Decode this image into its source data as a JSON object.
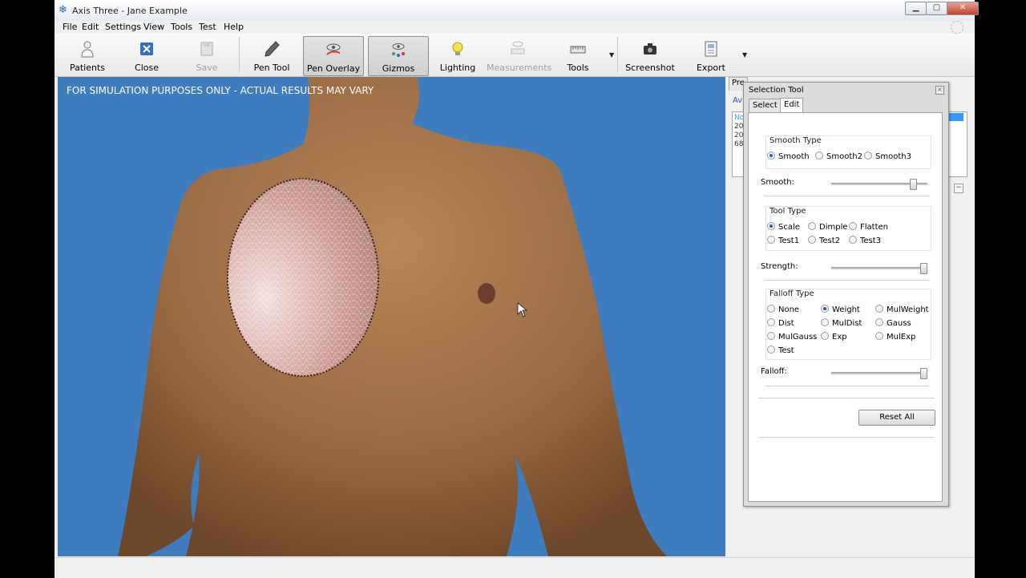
{
  "window": {
    "title": "Axis Three - Jane Example"
  },
  "menu": [
    "File",
    "Edit",
    "Settings",
    "View",
    "Tools",
    "Test",
    "Help"
  ],
  "toolbar": {
    "patients": "Patients",
    "close": "Close",
    "save": "Save",
    "pen_tool": "Pen Tool",
    "pen_overlay": "Pen Overlay",
    "gizmos": "Gizmos",
    "lighting": "Lighting",
    "measurements": "Measurements",
    "tools": "Tools",
    "screenshot": "Screenshot",
    "export": "Export"
  },
  "viewport": {
    "disclaimer": "FOR SIMULATION PURPOSES ONLY - ACTUAL RESULTS MAY VARY"
  },
  "background_panel": {
    "tab_partial": "Pre",
    "label_partial": "Av",
    "rows": [
      "No",
      "20",
      "20",
      "68"
    ]
  },
  "dialog": {
    "title": "Selection Tool",
    "tabs": [
      "Select",
      "Edit"
    ],
    "smooth_type": {
      "label": "Smooth Type",
      "options": [
        "Smooth",
        "Smooth2",
        "Smooth3"
      ],
      "selected": "Smooth"
    },
    "smooth_slider": {
      "label": "Smooth:",
      "value": 0.88
    },
    "tool_type": {
      "label": "Tool Type",
      "options": [
        "Scale",
        "Dimple",
        "Flatten",
        "Test1",
        "Test2",
        "Test3"
      ],
      "selected": "Scale"
    },
    "strength_slider": {
      "label": "Strength:",
      "value": 1.0
    },
    "falloff_type": {
      "label": "Falloff Type",
      "options": [
        "None",
        "Weight",
        "MulWeight",
        "Dist",
        "MulDist",
        "Gauss",
        "MulGauss",
        "Exp",
        "MulExp",
        "Test"
      ],
      "selected": "Weight"
    },
    "falloff_slider": {
      "label": "Falloff:",
      "value": 1.0
    },
    "reset_button": "Reset All"
  },
  "colors": {
    "viewport_bg": "#3d7cbe",
    "accent": "#3399ff"
  }
}
